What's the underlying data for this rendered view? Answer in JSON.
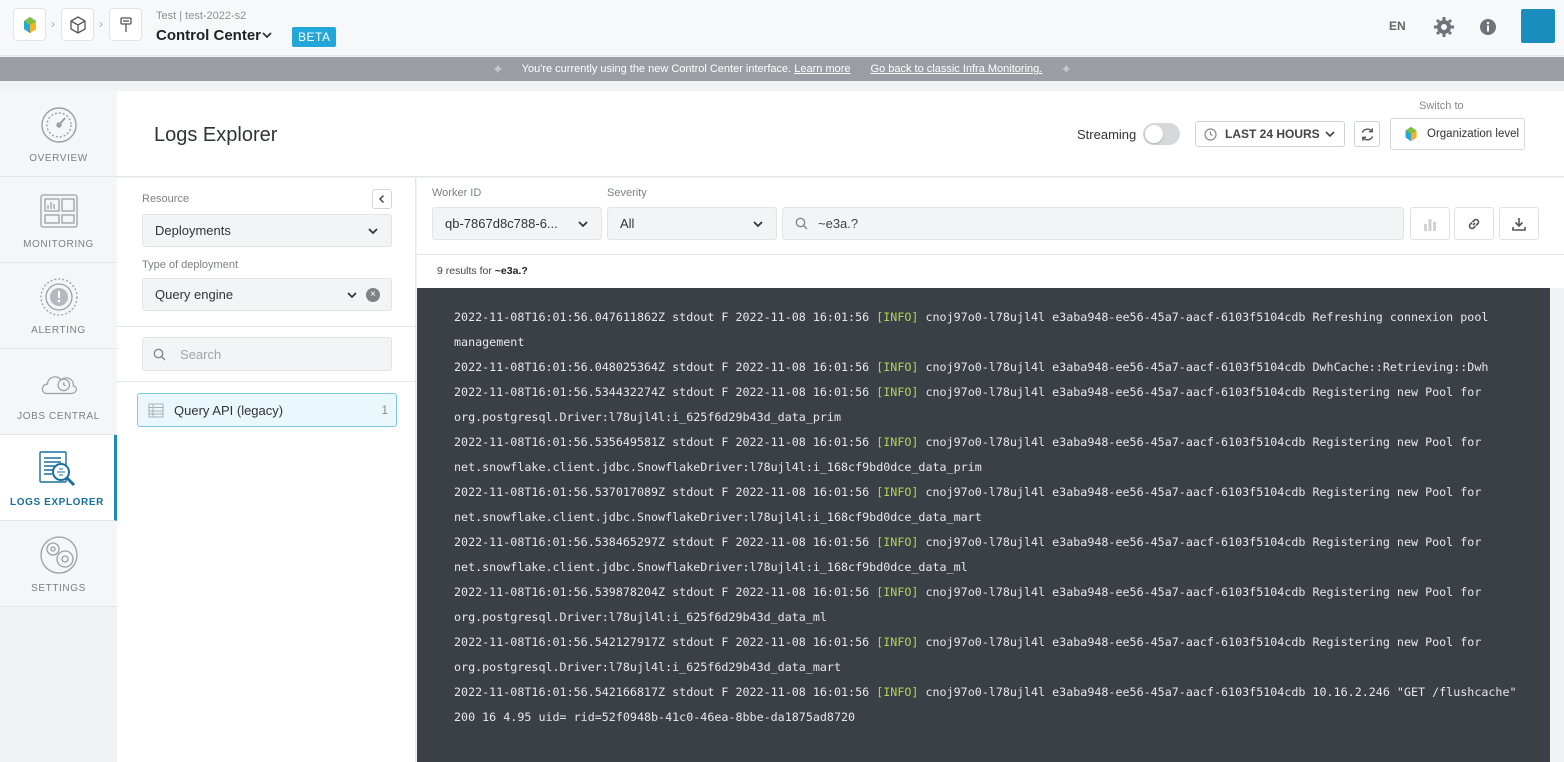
{
  "topbar": {
    "project_sub": "Test | test-2022-s2",
    "project_title": "Control Center",
    "beta": "BETA",
    "lang": "EN"
  },
  "banner": {
    "text": "You're currently using the new Control Center interface.",
    "learn_more": "Learn more",
    "go_back": "Go back to classic Infra Monitoring."
  },
  "nav": {
    "items": [
      {
        "label": "OVERVIEW",
        "icon": "gauge-icon"
      },
      {
        "label": "MONITORING",
        "icon": "dashboard-icon"
      },
      {
        "label": "ALERTING",
        "icon": "alert-icon"
      },
      {
        "label": "JOBS CENTRAL",
        "icon": "cloud-jobs-icon"
      },
      {
        "label": "LOGS EXPLORER",
        "icon": "logs-search-icon",
        "active": true
      },
      {
        "label": "SETTINGS",
        "icon": "settings-gear-icon"
      }
    ]
  },
  "header": {
    "title": "Logs Explorer",
    "streaming_label": "Streaming",
    "streaming_on": false,
    "time_range": "LAST 24 HOURS",
    "switch_to": "Switch to",
    "org_level": "Organization level"
  },
  "left_panel": {
    "resource_label": "Resource",
    "resource_value": "Deployments",
    "type_label": "Type of deployment",
    "type_value": "Query engine",
    "search_placeholder": "Search",
    "items": [
      {
        "label": "Query API (legacy)",
        "count": "1"
      }
    ]
  },
  "filters": {
    "worker_label": "Worker ID",
    "worker_value": "qb-7867d8c788-6...",
    "severity_label": "Severity",
    "severity_value": "All",
    "query": "~e3a.?",
    "results_prefix": "9 results for",
    "results_query": "~e3a.?"
  },
  "logs": [
    {
      "pre": "2022-11-08T16:01:56.047611862Z stdout F 2022-11-08 16:01:56 ",
      "level": "[INFO]",
      "msg": " cnoj97o0-l78ujl4l e3aba948-ee56-45a7-aacf-6103f5104cdb Refreshing connexion pool management"
    },
    {
      "pre": "2022-11-08T16:01:56.048025364Z stdout F 2022-11-08 16:01:56 ",
      "level": "[INFO]",
      "msg": " cnoj97o0-l78ujl4l e3aba948-ee56-45a7-aacf-6103f5104cdb DwhCache::Retrieving::Dwh"
    },
    {
      "pre": "2022-11-08T16:01:56.534432274Z stdout F 2022-11-08 16:01:56 ",
      "level": "[INFO]",
      "msg": " cnoj97o0-l78ujl4l e3aba948-ee56-45a7-aacf-6103f5104cdb Registering new Pool for org.postgresql.Driver:l78ujl4l:i_625f6d29b43d_data_prim"
    },
    {
      "pre": "2022-11-08T16:01:56.535649581Z stdout F 2022-11-08 16:01:56 ",
      "level": "[INFO]",
      "msg": " cnoj97o0-l78ujl4l e3aba948-ee56-45a7-aacf-6103f5104cdb Registering new Pool for net.snowflake.client.jdbc.SnowflakeDriver:l78ujl4l:i_168cf9bd0dce_data_prim"
    },
    {
      "pre": "2022-11-08T16:01:56.537017089Z stdout F 2022-11-08 16:01:56 ",
      "level": "[INFO]",
      "msg": " cnoj97o0-l78ujl4l e3aba948-ee56-45a7-aacf-6103f5104cdb Registering new Pool for net.snowflake.client.jdbc.SnowflakeDriver:l78ujl4l:i_168cf9bd0dce_data_mart"
    },
    {
      "pre": "2022-11-08T16:01:56.538465297Z stdout F 2022-11-08 16:01:56 ",
      "level": "[INFO]",
      "msg": " cnoj97o0-l78ujl4l e3aba948-ee56-45a7-aacf-6103f5104cdb Registering new Pool for net.snowflake.client.jdbc.SnowflakeDriver:l78ujl4l:i_168cf9bd0dce_data_ml"
    },
    {
      "pre": "2022-11-08T16:01:56.539878204Z stdout F 2022-11-08 16:01:56 ",
      "level": "[INFO]",
      "msg": " cnoj97o0-l78ujl4l e3aba948-ee56-45a7-aacf-6103f5104cdb Registering new Pool for org.postgresql.Driver:l78ujl4l:i_625f6d29b43d_data_ml"
    },
    {
      "pre": "2022-11-08T16:01:56.542127917Z stdout F 2022-11-08 16:01:56 ",
      "level": "[INFO]",
      "msg": " cnoj97o0-l78ujl4l e3aba948-ee56-45a7-aacf-6103f5104cdb Registering new Pool for org.postgresql.Driver:l78ujl4l:i_625f6d29b43d_data_mart"
    },
    {
      "pre": "2022-11-08T16:01:56.542166817Z stdout F 2022-11-08 16:01:56 ",
      "level": "[INFO]",
      "msg": " cnoj97o0-l78ujl4l e3aba948-ee56-45a7-aacf-6103f5104cdb 10.16.2.246 \"GET /flushcache\" 200 16 4.95 uid= rid=52f0948b-41c0-46ea-8bbe-da1875ad8720"
    }
  ],
  "colors": {
    "accent": "#1d8bba",
    "beta_bg": "#22a7d8",
    "log_bg": "#3b3f46",
    "info_level": "#b2d35a"
  }
}
